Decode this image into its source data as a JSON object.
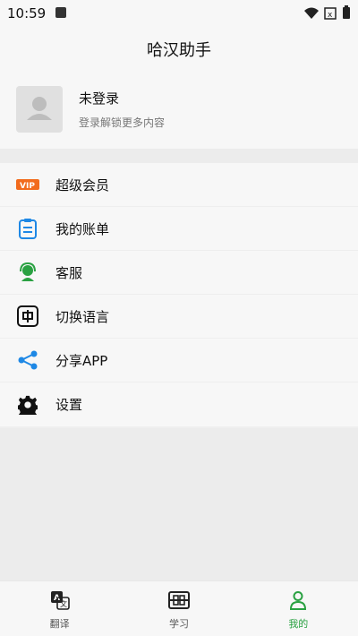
{
  "status": {
    "time": "10:59"
  },
  "header": {
    "title": "哈汉助手"
  },
  "profile": {
    "name": "未登录",
    "subtitle": "登录解锁更多内容"
  },
  "menu": [
    {
      "label": "超级会员",
      "icon": "vip-icon"
    },
    {
      "label": "我的账单",
      "icon": "bill-icon"
    },
    {
      "label": "客服",
      "icon": "customer-service-icon"
    },
    {
      "label": "切换语言",
      "icon": "language-icon"
    },
    {
      "label": "分享APP",
      "icon": "share-icon"
    },
    {
      "label": "设置",
      "icon": "gear-icon"
    }
  ],
  "bottom_nav": [
    {
      "label": "翻译",
      "icon": "translate-icon",
      "active": false
    },
    {
      "label": "学习",
      "icon": "study-icon",
      "active": false
    },
    {
      "label": "我的",
      "icon": "user-icon",
      "active": true
    }
  ],
  "colors": {
    "accent": "#2aa142",
    "vip": "#f26b1d",
    "blue": "#1e88e5"
  }
}
